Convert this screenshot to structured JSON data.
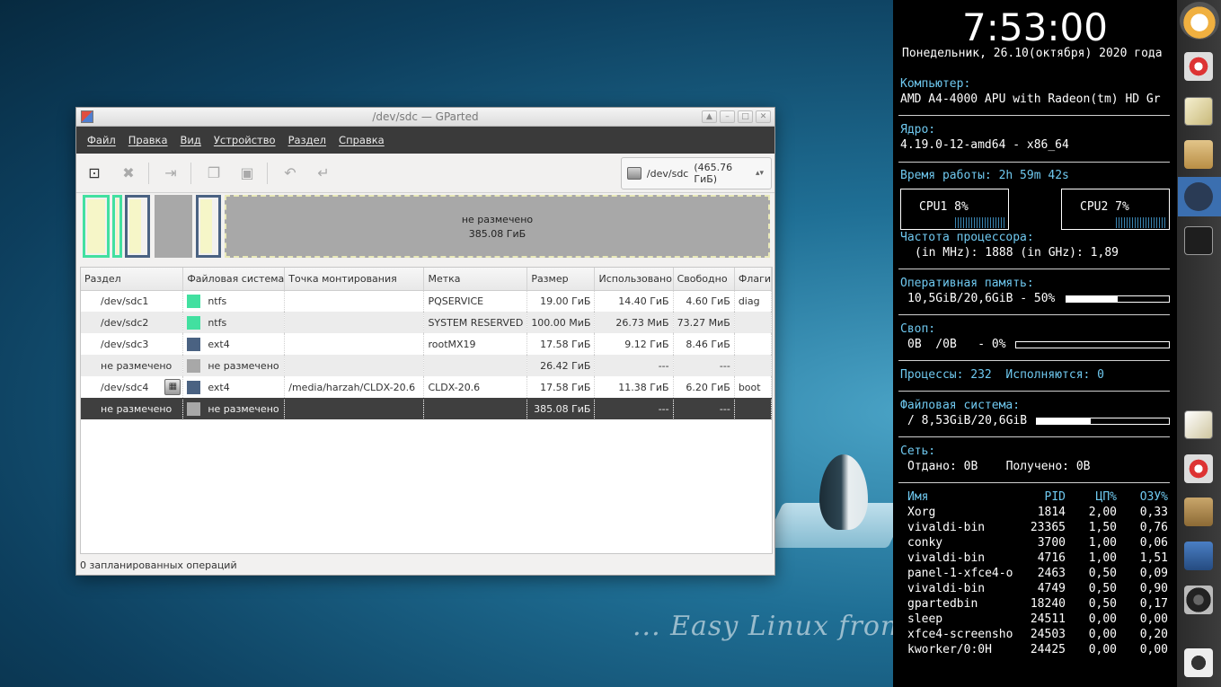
{
  "desktop": {
    "tagline": "... Easy Linux from the Sc"
  },
  "window": {
    "title": "/dev/sdc — GParted",
    "menu": [
      "Файл",
      "Правка",
      "Вид",
      "Устройство",
      "Раздел",
      "Справка"
    ],
    "device_selector": {
      "device": "/dev/sdc",
      "size": "(465.76 ГиБ)"
    },
    "diskmap": {
      "unallocated_label": "не размечено",
      "unallocated_size": "385.08 ГиБ"
    },
    "columns": [
      "Раздел",
      "Файловая система",
      "Точка монтирования",
      "Метка",
      "Размер",
      "Использовано",
      "Свободно",
      "Флаги"
    ],
    "rows": [
      {
        "part": "/dev/sdc1",
        "fs": "ntfs",
        "fs_color": "#42e0a0",
        "mount": "",
        "label": "PQSERVICE",
        "size": "19.00 ГиБ",
        "used": "14.40 ГиБ",
        "free": "4.60 ГиБ",
        "flags": "diag"
      },
      {
        "part": "/dev/sdc2",
        "fs": "ntfs",
        "fs_color": "#42e0a0",
        "mount": "",
        "label": "SYSTEM RESERVED",
        "size": "100.00 МиБ",
        "used": "26.73 МиБ",
        "free": "73.27 МиБ",
        "flags": ""
      },
      {
        "part": "/dev/sdc3",
        "fs": "ext4",
        "fs_color": "#4a6282",
        "mount": "",
        "label": "rootMX19",
        "size": "17.58 ГиБ",
        "used": "9.12 ГиБ",
        "free": "8.46 ГиБ",
        "flags": ""
      },
      {
        "part": "не размечено",
        "fs": "не размечено",
        "fs_color": "#a8a8a8",
        "mount": "",
        "label": "",
        "size": "26.42 ГиБ",
        "used": "---",
        "free": "---",
        "flags": ""
      },
      {
        "part": "/dev/sdc4",
        "fs": "ext4",
        "fs_color": "#4a6282",
        "mount": "/media/harzah/CLDX-20.6",
        "label": "CLDX-20.6",
        "size": "17.58 ГиБ",
        "used": "11.38 ГиБ",
        "free": "6.20 ГиБ",
        "flags": "boot"
      },
      {
        "part": "не размечено",
        "fs": "не размечено",
        "fs_color": "#a8a8a8",
        "mount": "",
        "label": "",
        "size": "385.08 ГиБ",
        "used": "---",
        "free": "---",
        "flags": ""
      }
    ],
    "status": "0 запланированных операций"
  },
  "conky": {
    "time": "7:53:00",
    "date": "Понедельник, 26.10(октября) 2020 года",
    "computer_h": "Компьютер:",
    "computer_v": "AMD A4-4000 APU with Radeon(tm) HD Gr",
    "kernel_h": "Ядро:",
    "kernel_v": "4.19.0-12-amd64 - x86_64",
    "uptime_h": "Время работы:",
    "uptime_v": "2h 59m 42s",
    "cpu1": "CPU1   8%",
    "cpu2": "CPU2   7%",
    "freq_h": "Частота процессора:",
    "freq_v": "(in MHz): 1888 (in GHz): 1,89",
    "ram_h": "Оперативная память:",
    "ram_v": "10,5GiB/20,6GiB - 50%",
    "ram_pct": 50,
    "swap_h": "Своп:",
    "swap_v": "0B  /0B   - 0%",
    "swap_pct": 0,
    "procs_h": "Процессы:",
    "procs_v": "232",
    "running_h": "Исполняются:",
    "running_v": "0",
    "fs_h": "Файловая система:",
    "fs_v": "/ 8,53GiB/20,6GiB",
    "fs_pct": 41,
    "net_h": "Сеть:",
    "net_v": "Отдано: 0B    Получено: 0B",
    "proc_cols": [
      "Имя",
      "PID",
      "ЦП%",
      "ОЗУ%"
    ],
    "processes": [
      [
        "Xorg",
        "1814",
        "2,00",
        "0,33"
      ],
      [
        "vivaldi-bin",
        "23365",
        "1,50",
        "0,76"
      ],
      [
        "conky",
        "3700",
        "1,00",
        "0,06"
      ],
      [
        "vivaldi-bin",
        "4716",
        "1,00",
        "1,51"
      ],
      [
        "panel-1-xfce4-o",
        "2463",
        "0,50",
        "0,09"
      ],
      [
        "vivaldi-bin",
        "4749",
        "0,50",
        "0,90"
      ],
      [
        "gpartedbin",
        "18240",
        "0,50",
        "0,17"
      ],
      [
        "sleep",
        "24511",
        "0,00",
        "0,00"
      ],
      [
        "xfce4-screensho",
        "24503",
        "0,00",
        "0,20"
      ],
      [
        "kworker/0:0H",
        "24425",
        "0,00",
        "0,00"
      ]
    ]
  }
}
